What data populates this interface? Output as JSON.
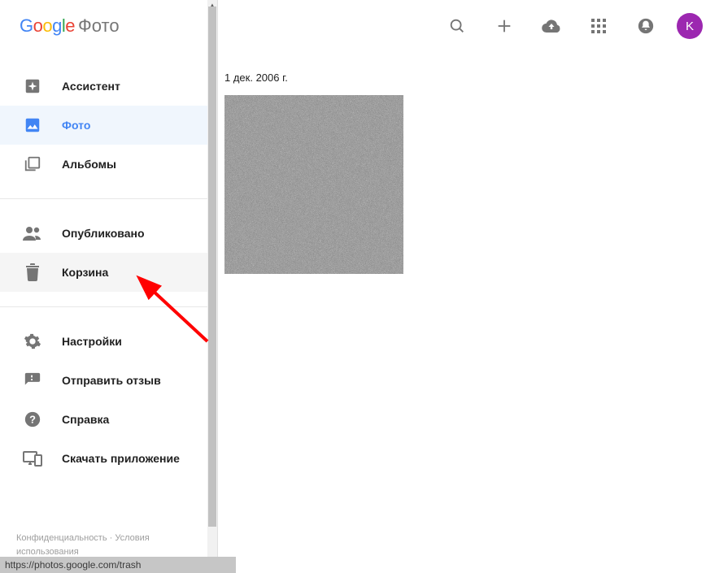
{
  "logo": {
    "prefix_letters": [
      "G",
      "o",
      "o",
      "g",
      "l",
      "e"
    ],
    "app_name": "Фото"
  },
  "sidebar": {
    "groups": [
      {
        "items": [
          {
            "id": "assistant",
            "label": "Ассистент",
            "icon": "assistant"
          },
          {
            "id": "photos",
            "label": "Фото",
            "icon": "photo",
            "active": true
          },
          {
            "id": "albums",
            "label": "Альбомы",
            "icon": "albums"
          }
        ]
      },
      {
        "items": [
          {
            "id": "shared",
            "label": "Опубликовано",
            "icon": "people"
          },
          {
            "id": "trash",
            "label": "Корзина",
            "icon": "trash",
            "hover": true
          }
        ]
      },
      {
        "items": [
          {
            "id": "settings",
            "label": "Настройки",
            "icon": "gear"
          },
          {
            "id": "feedback",
            "label": "Отправить отзыв",
            "icon": "feedback"
          },
          {
            "id": "help",
            "label": "Справка",
            "icon": "help"
          },
          {
            "id": "download",
            "label": "Скачать приложение",
            "icon": "devices"
          }
        ]
      }
    ],
    "footer": {
      "privacy": "Конфиденциальность",
      "sep": " · ",
      "terms": "Условия использования"
    }
  },
  "topbar": {
    "icons": [
      "search",
      "add",
      "upload",
      "apps",
      "notifications"
    ],
    "avatar_letter": "K",
    "avatar_color": "#9C27B0"
  },
  "content": {
    "date_header": "1 дек. 2006 г."
  },
  "status_bar": "https://photos.google.com/trash"
}
